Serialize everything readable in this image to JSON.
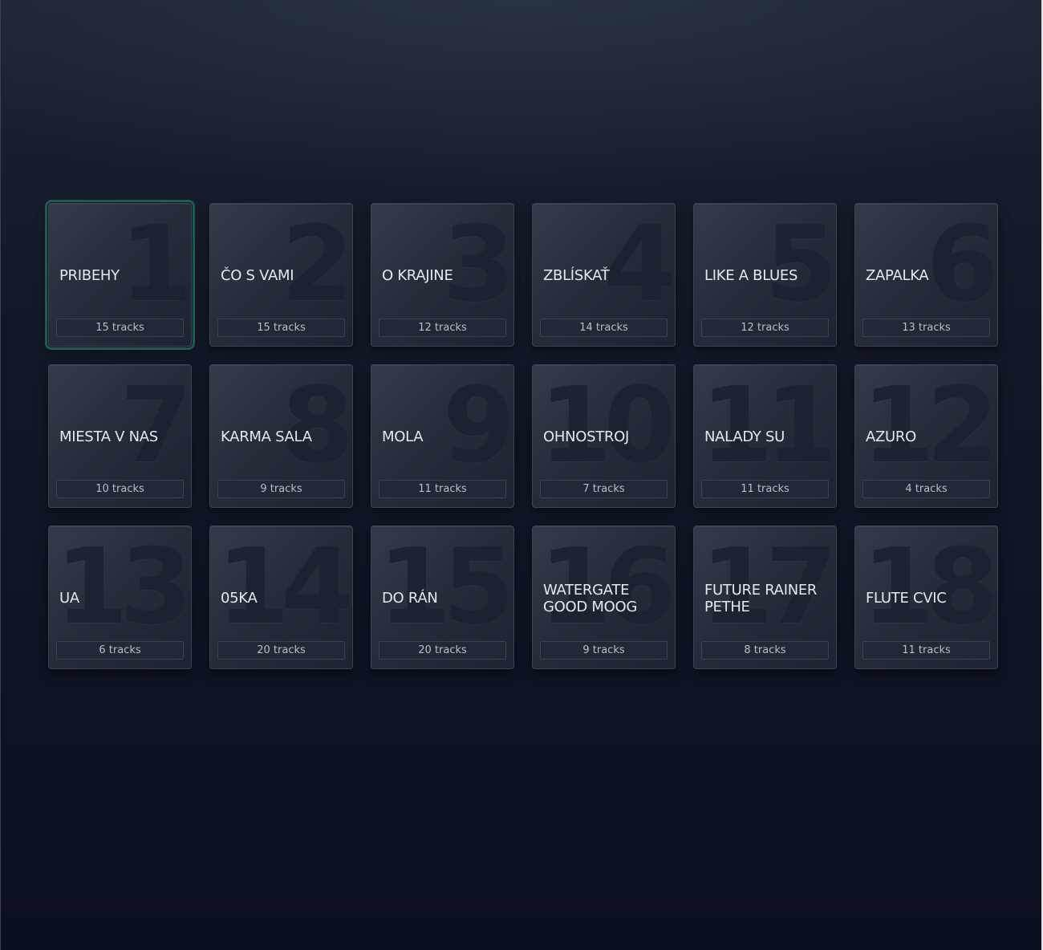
{
  "albums": [
    {
      "number": "1",
      "title": "PRIBEHY",
      "tracks": "15 tracks",
      "selected": true
    },
    {
      "number": "2",
      "title": "ČO S VAMI",
      "tracks": "15 tracks"
    },
    {
      "number": "3",
      "title": "O KRAJINE",
      "tracks": "12 tracks"
    },
    {
      "number": "4",
      "title": "ZBLÍSKAŤ",
      "tracks": "14 tracks"
    },
    {
      "number": "5",
      "title": "LIKE A BLUES",
      "tracks": "12 tracks"
    },
    {
      "number": "6",
      "title": "ZAPALKA",
      "tracks": "13 tracks"
    },
    {
      "number": "7",
      "title": "MIESTA V NAS",
      "tracks": "10 tracks"
    },
    {
      "number": "8",
      "title": "KARMA SALA",
      "tracks": "9 tracks"
    },
    {
      "number": "9",
      "title": "MOLA",
      "tracks": "11 tracks"
    },
    {
      "number": "10",
      "title": "OHNOSTROJ",
      "tracks": "7 tracks"
    },
    {
      "number": "11",
      "title": "NALADY SU",
      "tracks": "11 tracks"
    },
    {
      "number": "12",
      "title": "AZURO",
      "tracks": "4 tracks"
    },
    {
      "number": "13",
      "title": "UA",
      "tracks": "6 tracks"
    },
    {
      "number": "14",
      "title": "05KA",
      "tracks": "20 tracks"
    },
    {
      "number": "15",
      "title": "DO RÁN",
      "tracks": "20 tracks"
    },
    {
      "number": "16",
      "title": "WATERGATE GOOD MOOG",
      "tracks": "9 tracks"
    },
    {
      "number": "17",
      "title": "FUTURE RAINER PETHE",
      "tracks": "8 tracks"
    },
    {
      "number": "18",
      "title": "FLUTE CVIC",
      "tracks": "11 tracks"
    }
  ],
  "colors": {
    "selected_outline": "#1f5a55",
    "card_title": "#e6e9ee",
    "card_count": "#b9bfc9",
    "background_top": "#1b2230",
    "background_bottom": "#0b1020"
  }
}
